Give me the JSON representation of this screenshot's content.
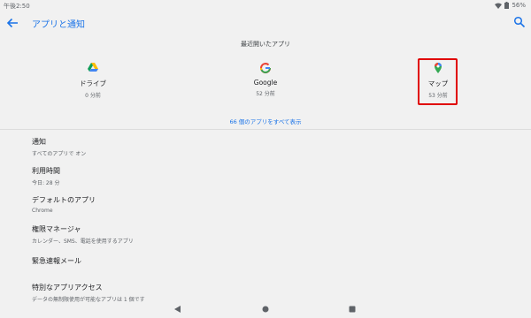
{
  "status_bar": {
    "time": "午後2:50",
    "battery": "56%",
    "wifi_icon": "wifi-icon",
    "battery_icon": "battery-icon"
  },
  "app_bar": {
    "title": "アプリと通知",
    "back_icon": "arrow-left-icon",
    "search_icon": "search-icon",
    "accent": "#1a73e8"
  },
  "recent": {
    "header": "最近開いたアプリ",
    "apps": [
      {
        "name": "ドライブ",
        "time": "0 分前",
        "icon": "google-drive-icon"
      },
      {
        "name": "Google",
        "time": "52 分前",
        "icon": "google-g-icon"
      },
      {
        "name": "マップ",
        "time": "53 分前",
        "icon": "google-maps-icon",
        "highlighted": true
      }
    ],
    "see_all": "66 個のアプリをすべて表示",
    "highlight_color": "#e00000"
  },
  "settings": [
    {
      "title": "通知",
      "subtitle": "すべてのアプリで オン"
    },
    {
      "title": "利用時間",
      "subtitle": "今日: 28 分"
    },
    {
      "title": "デフォルトのアプリ",
      "subtitle": "Chrome"
    },
    {
      "title": "権限マネージャ",
      "subtitle": "カレンダー、SMS、電話を使用するアプリ"
    },
    {
      "title": "緊急速報メール",
      "subtitle": ""
    },
    {
      "title": "特別なアプリアクセス",
      "subtitle": "データの無制限使用が可能なアプリは 1 個です"
    }
  ],
  "nav_bar": {
    "back_icon": "triangle-back-icon",
    "home_icon": "circle-home-icon",
    "recents_icon": "square-recents-icon"
  }
}
